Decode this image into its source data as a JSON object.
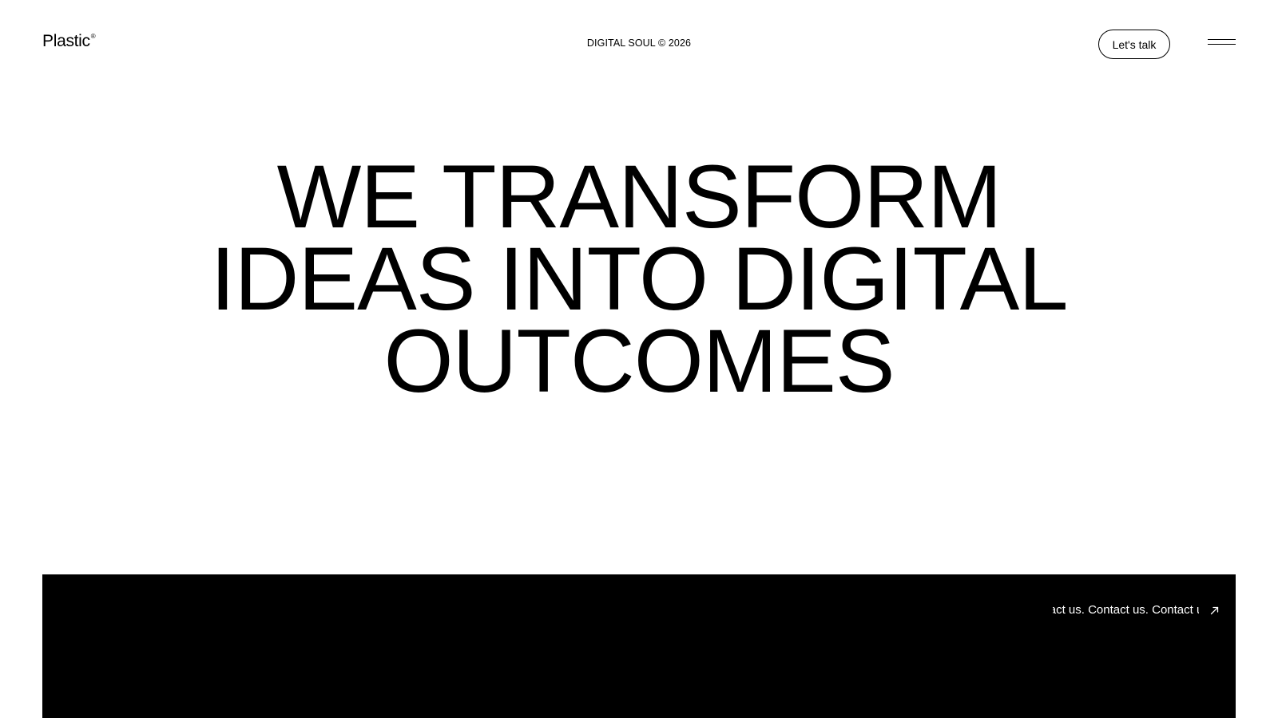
{
  "header": {
    "logo_text": "Plastic",
    "logo_mark": "®",
    "tagline": "DIGITAL SOUL © 2026",
    "cta_label": "Let's talk",
    "menu_icon": "hamburger-menu-icon"
  },
  "hero": {
    "lines": [
      "WE TRANSFORM",
      "IDEAS INTO DIGITAL",
      "OUTCOMES"
    ]
  },
  "contact_panel": {
    "marquee_text": "Contact us. Contact us. Contact us. Contact us.",
    "arrow_icon": "arrow-up-right-icon"
  },
  "colors": {
    "background": "#ffffff",
    "text": "#000000",
    "panel": "#000000",
    "panel_text": "#ffffff"
  }
}
